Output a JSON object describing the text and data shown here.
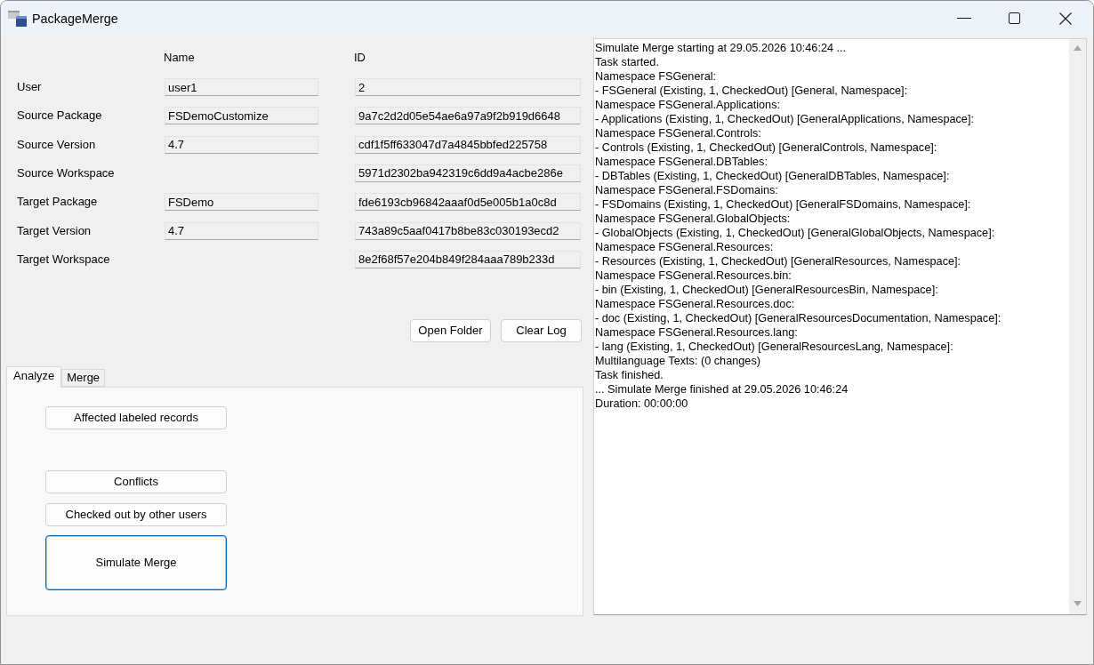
{
  "window": {
    "title": "PackageMerge"
  },
  "form": {
    "columns": [
      "Name",
      "ID"
    ],
    "rows": [
      {
        "label": "User",
        "name": "user1",
        "id": "2"
      },
      {
        "label": "Source Package",
        "name": "FSDemoCustomize",
        "id": "9a7c2d2d05e54ae6a97a9f2b919d6648"
      },
      {
        "label": "Source Version",
        "name": "4.7",
        "id": "cdf1f5ff633047d7a4845bbfed225758"
      },
      {
        "label": "Source Workspace",
        "id": "5971d2302ba942319c6dd9a4acbe286e"
      },
      {
        "label": "Target Package",
        "name": "FSDemo",
        "id": "fde6193cb96842aaaf0d5e005b1a0c8d"
      },
      {
        "label": "Target Version",
        "name": "4.7",
        "id": "743a89c5aaf0417b8be83c030193ecd2"
      },
      {
        "label": "Target Workspace",
        "id": "8e2f68f57e204b849f284aaa789b233d"
      }
    ]
  },
  "log_actions": [
    "Open Folder",
    "Clear Log"
  ],
  "tabs": [
    {
      "label": "Analyze",
      "selected": true
    },
    {
      "label": "Merge",
      "selected": false
    }
  ],
  "analyze_buttons": [
    {
      "label": "Affected labeled records",
      "focused": false
    },
    {
      "label": "Conflicts",
      "focused": false
    },
    {
      "label": "Checked out by other users",
      "focused": false
    },
    {
      "label": "Simulate Merge",
      "focused": true
    }
  ],
  "log": {
    "lines": [
      "Simulate Merge starting at 29.05.2026 10:46:24 ...",
      "Task started.",
      "Namespace FSGeneral:",
      "- FSGeneral (Existing, 1, CheckedOut) [General, Namespace]:",
      "Namespace FSGeneral.Applications:",
      "- Applications (Existing, 1, CheckedOut) [GeneralApplications, Namespace]:",
      "Namespace FSGeneral.Controls:",
      "- Controls (Existing, 1, CheckedOut) [GeneralControls, Namespace]:",
      "Namespace FSGeneral.DBTables:",
      "- DBTables (Existing, 1, CheckedOut) [GeneralDBTables, Namespace]:",
      "Namespace FSGeneral.FSDomains:",
      "- FSDomains (Existing, 1, CheckedOut) [GeneralFSDomains, Namespace]:",
      "Namespace FSGeneral.GlobalObjects:",
      "- GlobalObjects (Existing, 1, CheckedOut) [GeneralGlobalObjects, Namespace]:",
      "Namespace FSGeneral.Resources:",
      "- Resources (Existing, 1, CheckedOut) [GeneralResources, Namespace]:",
      "Namespace FSGeneral.Resources.bin:",
      "- bin (Existing, 1, CheckedOut) [GeneralResourcesBin, Namespace]:",
      "Namespace FSGeneral.Resources.doc:",
      "- doc (Existing, 1, CheckedOut) [GeneralResourcesDocumentation, Namespace]:",
      "Namespace FSGeneral.Resources.lang:",
      "- lang (Existing, 1, CheckedOut) [GeneralResourcesLang, Namespace]:",
      "Multilanguage Texts: (0 changes)",
      "Task finished.",
      "... Simulate Merge finished at 29.05.2026 10:46:24",
      "Duration: 00:00:00"
    ]
  }
}
